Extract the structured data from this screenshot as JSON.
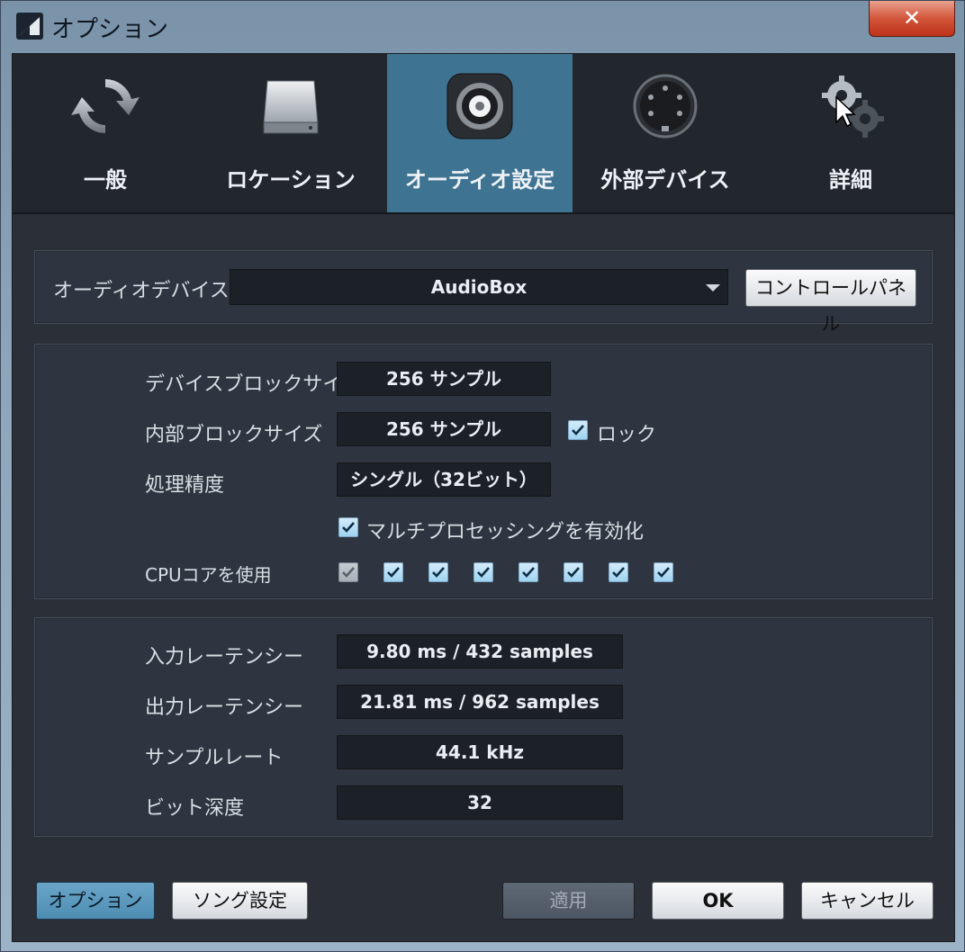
{
  "window": {
    "title": "オプション",
    "close_label": "✕"
  },
  "tabs": [
    {
      "label": "一般",
      "icon": "refresh-icon",
      "active": false
    },
    {
      "label": "ロケーション",
      "icon": "drive-icon",
      "active": false
    },
    {
      "label": "オーディオ設定",
      "icon": "speaker-icon",
      "active": true
    },
    {
      "label": "外部デバイス",
      "icon": "midi-port-icon",
      "active": false
    },
    {
      "label": "詳細",
      "icon": "gears-icon",
      "active": false
    }
  ],
  "device": {
    "label": "オーディオデバイス",
    "selected": "AudioBox",
    "control_panel_button": "コントロールパネル"
  },
  "processing": {
    "device_block_size_label": "デバイスブロックサイズ",
    "device_block_size_value": "256 サンプル",
    "internal_block_size_label": "内部ブロックサイズ",
    "internal_block_size_value": "256 サンプル",
    "lock_label": "ロック",
    "lock_checked": true,
    "precision_label": "処理精度",
    "precision_value": "シングル（32ビット）",
    "multiprocessing_label": "マルチプロセッシングを有効化",
    "multiprocessing_checked": true,
    "cpu_cores_label": "CPUコアを使用",
    "cpu_cores": [
      true,
      true,
      true,
      true,
      true,
      true,
      true,
      true
    ],
    "cpu_core_first_disabled": true
  },
  "latency": {
    "input_label": "入力レーテンシー",
    "input_value": "9.80 ms / 432 samples",
    "output_label": "出力レーテンシー",
    "output_value": "21.81 ms / 962 samples",
    "sample_rate_label": "サンプルレート",
    "sample_rate_value": "44.1 kHz",
    "bit_depth_label": "ビット深度",
    "bit_depth_value": "32"
  },
  "footer": {
    "options_button": "オプション",
    "song_settings_button": "ソング設定",
    "apply_button": "適用",
    "ok_button": "OK",
    "cancel_button": "キャンセル"
  },
  "colors": {
    "active_tab": "#3f7392",
    "panel": "#2e3540",
    "field": "#1c2027",
    "close_button": "#d2553b"
  }
}
